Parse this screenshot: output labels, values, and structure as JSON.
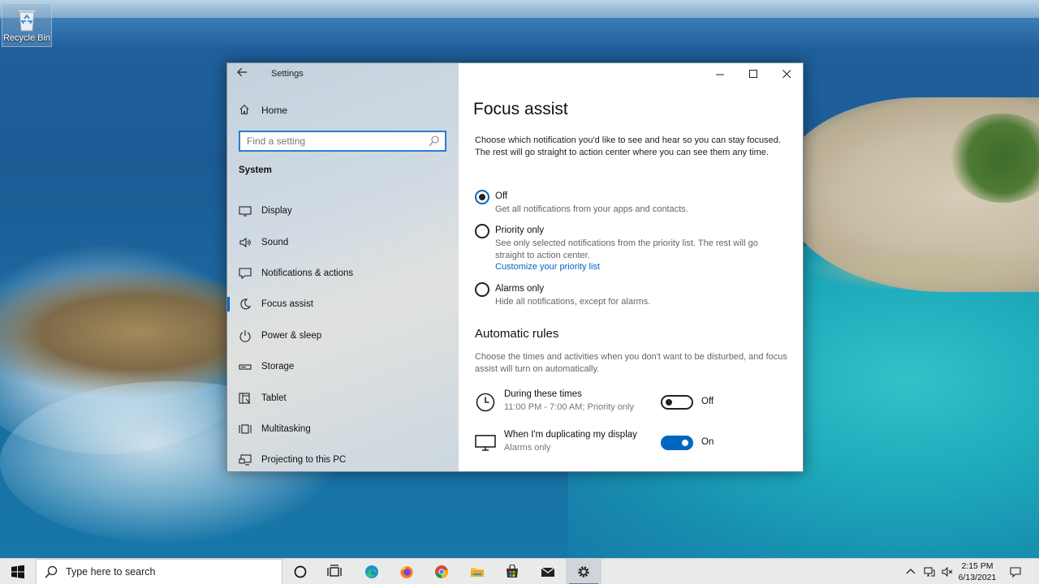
{
  "desktop": {
    "recycle_bin_label": "Recycle Bin"
  },
  "window": {
    "app_title": "Settings",
    "nav": {
      "home_label": "Home",
      "search_placeholder": "Find a setting",
      "section_label": "System",
      "items": [
        {
          "label": "Display",
          "icon": "monitor-icon",
          "active": false
        },
        {
          "label": "Sound",
          "icon": "speaker-icon",
          "active": false
        },
        {
          "label": "Notifications & actions",
          "icon": "notification-icon",
          "active": false
        },
        {
          "label": "Focus assist",
          "icon": "moon-icon",
          "active": true
        },
        {
          "label": "Power & sleep",
          "icon": "power-icon",
          "active": false
        },
        {
          "label": "Storage",
          "icon": "storage-icon",
          "active": false
        },
        {
          "label": "Tablet",
          "icon": "tablet-icon",
          "active": false
        },
        {
          "label": "Multitasking",
          "icon": "multitasking-icon",
          "active": false
        },
        {
          "label": "Projecting to this PC",
          "icon": "projecting-icon",
          "active": false
        }
      ]
    },
    "content": {
      "title": "Focus assist",
      "intro": "Choose which notification you'd like to see and hear so you can stay focused. The rest will go straight to action center where you can see them any time.",
      "options": [
        {
          "label": "Off",
          "desc": "Get all notifications from your apps and contacts.",
          "selected": true
        },
        {
          "label": "Priority only",
          "desc": "See only selected notifications from the priority list. The rest will go straight to action center.",
          "link": "Customize your priority list",
          "selected": false
        },
        {
          "label": "Alarms only",
          "desc": "Hide all notifications, except for alarms.",
          "selected": false
        }
      ],
      "rules_title": "Automatic rules",
      "rules_desc": "Choose the times and activities when you don't want to be disturbed, and focus assist will turn on automatically.",
      "rules": [
        {
          "label": "During these times",
          "sub": "11:00 PM - 7:00 AM; Priority only",
          "state": "Off",
          "icon": "clock-icon"
        },
        {
          "label": "When I'm duplicating my display",
          "sub": "Alarms only",
          "state": "On",
          "icon": "monitor-icon"
        }
      ]
    }
  },
  "taskbar": {
    "search_placeholder": "Type here to search",
    "clock_time": "2:15 PM",
    "clock_date": "6/13/2021",
    "accent": "#0067c0"
  }
}
